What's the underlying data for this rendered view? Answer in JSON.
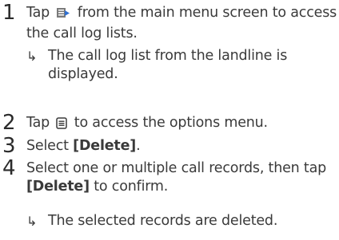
{
  "steps": [
    {
      "number": "1",
      "text_before_icon": "Tap",
      "icon": "call-log-icon",
      "text_after_icon": "from the main menu screen to access the call log lists.",
      "result_arrow": "↳",
      "result": "The call log list from the landline is displayed."
    },
    {
      "number": "2",
      "text_before_icon": "Tap",
      "icon": "options-menu-icon",
      "text_after_icon": "to access the options menu."
    },
    {
      "number": "3",
      "text": "Select ",
      "bold": "[Delete]",
      "text_end": "."
    },
    {
      "number": "4",
      "text": "Select one or multiple call records, then tap ",
      "bold": "[Delete]",
      "text_end": " to confirm.",
      "result_arrow": "↳",
      "result": "The selected records are deleted."
    }
  ]
}
